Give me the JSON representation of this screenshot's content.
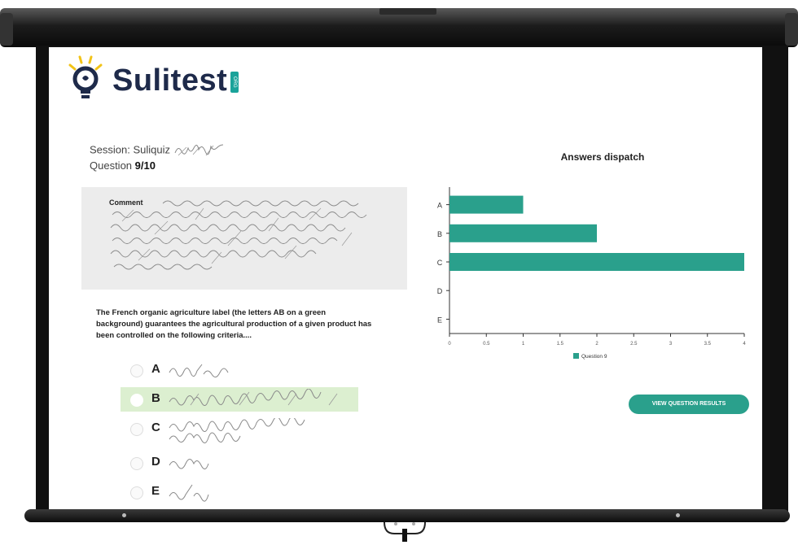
{
  "brand": {
    "name": "Sulitest",
    "badge": "ORG"
  },
  "session": {
    "label": "Session: Suliquiz"
  },
  "question": {
    "prefix": "Question ",
    "number": "9/10"
  },
  "comment": {
    "label": "Comment"
  },
  "question_text": "The French organic agriculture label (the letters AB on a green background) guarantees the agricultural production of a given product has been controlled on the following criteria....",
  "answers": [
    {
      "letter": "A",
      "selected": false
    },
    {
      "letter": "B",
      "selected": true
    },
    {
      "letter": "C",
      "selected": false
    },
    {
      "letter": "D",
      "selected": false
    },
    {
      "letter": "E",
      "selected": false
    }
  ],
  "view_button": "VIEW QUESTION RESULTS",
  "colors": {
    "accent": "#2aa08c",
    "selected_bg": "#dcefd0",
    "brand_dark": "#1e2a4a",
    "bulb": "#f2c318"
  },
  "chart_data": {
    "type": "bar",
    "orientation": "horizontal",
    "title": "Answers dispatch",
    "categories": [
      "A",
      "B",
      "C",
      "D",
      "E"
    ],
    "series": [
      {
        "name": "Question 9",
        "values": [
          1,
          2,
          4,
          0,
          0
        ]
      }
    ],
    "xlim": [
      0,
      4
    ],
    "xticks": [
      "0",
      "0.5",
      "1",
      "1.5",
      "2",
      "2.5",
      "3",
      "3.5",
      "4"
    ],
    "grid": false,
    "legend": "bottom-center"
  }
}
